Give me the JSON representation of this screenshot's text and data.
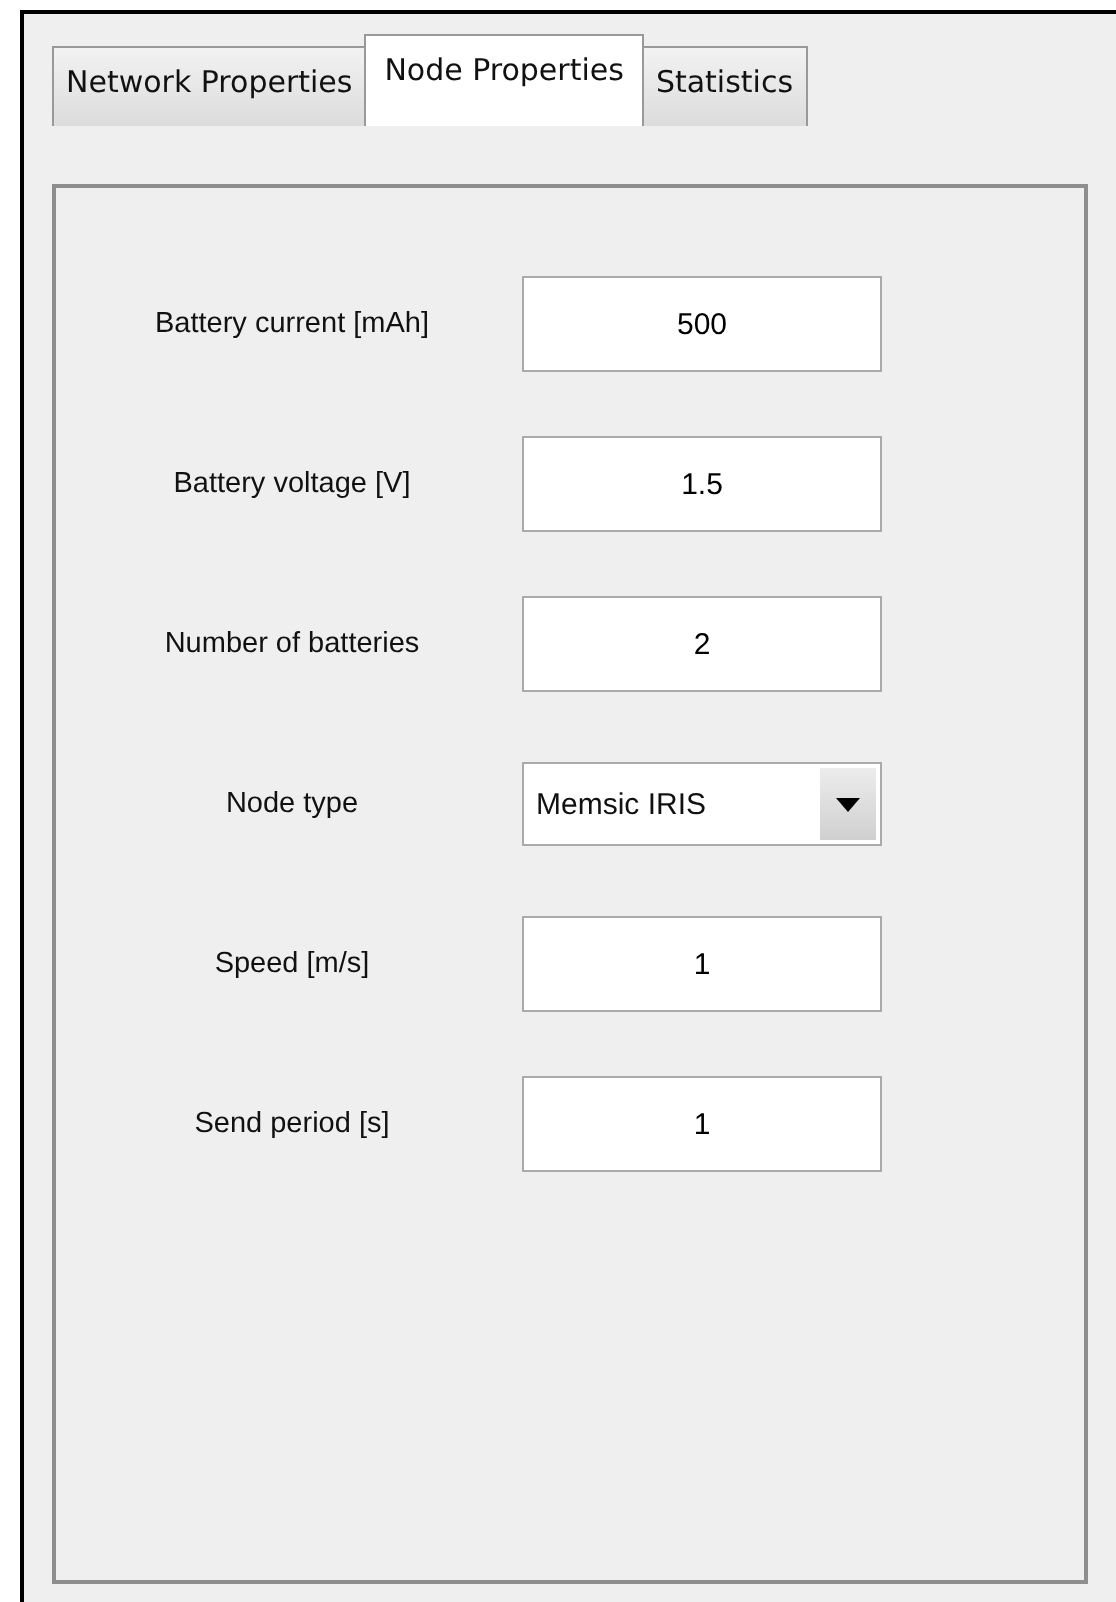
{
  "tabs": [
    {
      "label": "Network Properties",
      "selected": false
    },
    {
      "label": "Node Properties",
      "selected": true
    },
    {
      "label": "Statistics",
      "selected": false
    }
  ],
  "fields": [
    {
      "kind": "text",
      "label": "Battery current [mAh]",
      "value": "500"
    },
    {
      "kind": "text",
      "label": "Battery voltage [V]",
      "value": "1.5"
    },
    {
      "kind": "text",
      "label": "Number of batteries",
      "value": "2"
    },
    {
      "kind": "select",
      "label": "Node type",
      "value": "Memsic IRIS"
    },
    {
      "kind": "text",
      "label": "Speed [m/s]",
      "value": "1"
    },
    {
      "kind": "text",
      "label": "Send period [s]",
      "value": "1"
    }
  ]
}
